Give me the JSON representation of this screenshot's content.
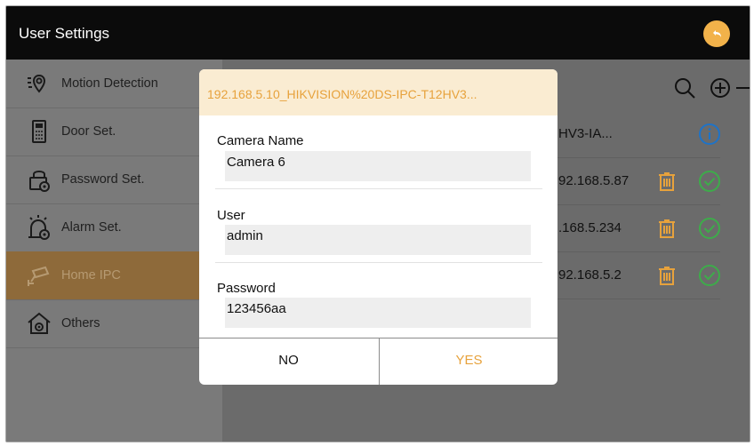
{
  "header": {
    "title": "User Settings",
    "back_icon": "back-arrow-icon",
    "accent": "#f2b24a"
  },
  "sidebar": {
    "items": [
      {
        "label": "Motion Detection",
        "icon": "motion-detection-icon"
      },
      {
        "label": "Door Set.",
        "icon": "door-station-icon"
      },
      {
        "label": "Password Set.",
        "icon": "password-lock-icon"
      },
      {
        "label": "Alarm Set.",
        "icon": "alarm-icon"
      },
      {
        "label": "Home IPC",
        "icon": "ip-camera-icon",
        "active": true
      },
      {
        "label": "Others",
        "icon": "home-settings-icon"
      }
    ]
  },
  "toolbar": {
    "search_icon": "search-icon",
    "add_icon": "add-icon"
  },
  "camera_list": [
    {
      "address": "HV3-IA...",
      "icon": "info-icon"
    },
    {
      "address": "92.168.5.87",
      "delete_icon": "trash-icon",
      "status_icon": "check-circle-icon"
    },
    {
      "address": ".168.5.234",
      "delete_icon": "trash-icon",
      "status_icon": "check-circle-icon"
    },
    {
      "address": "92.168.5.2",
      "delete_icon": "trash-icon",
      "status_icon": "check-circle-icon"
    }
  ],
  "dialog": {
    "title": "192.168.5.10_HIKVISION%20DS-IPC-T12HV3...",
    "fields": [
      {
        "label": "Camera Name",
        "value": "Camera 6"
      },
      {
        "label": "User",
        "value": "admin"
      },
      {
        "label": "Password",
        "value": "123456aa"
      }
    ],
    "no_label": "NO",
    "yes_label": "YES"
  },
  "colors": {
    "accent": "#e7a23c",
    "ok_green": "#3dac4a",
    "info_blue": "#1e73c8"
  }
}
